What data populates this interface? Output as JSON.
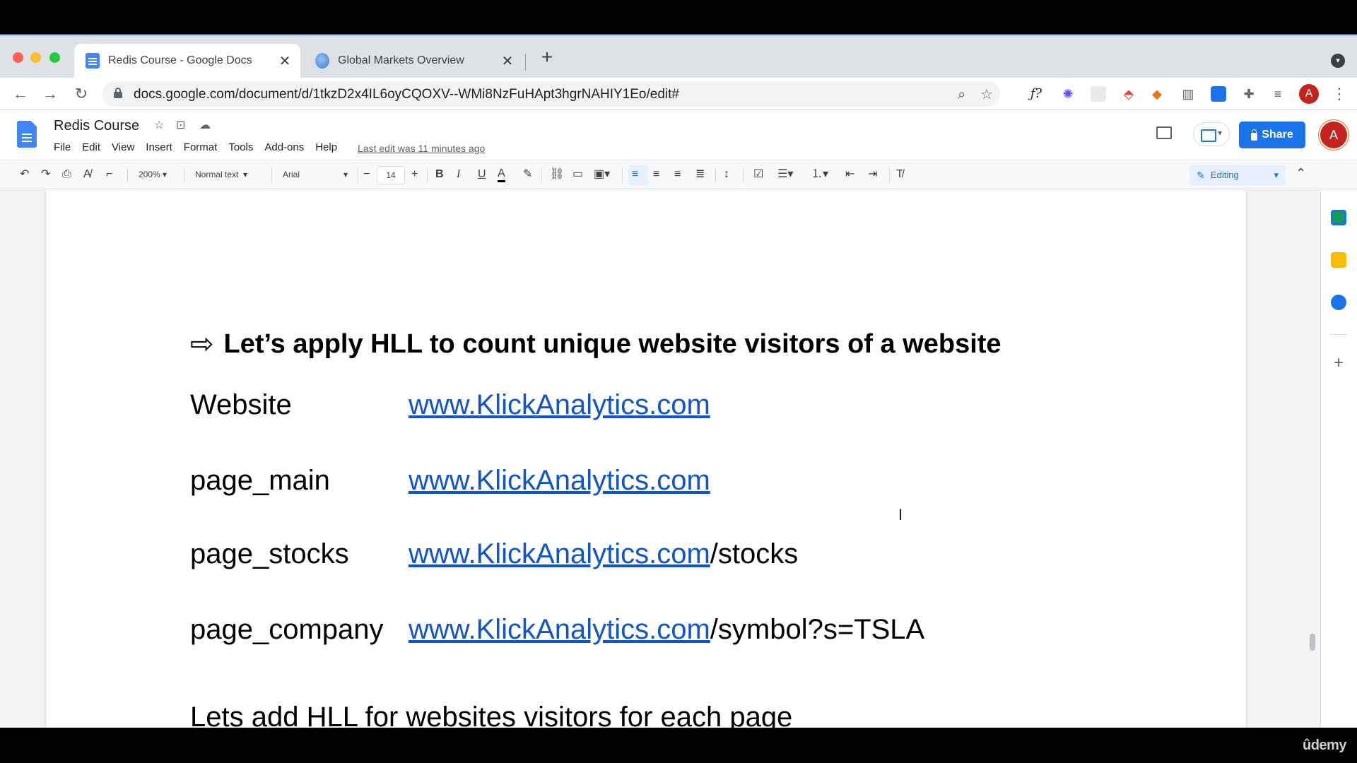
{
  "browser": {
    "tabs": [
      {
        "title": "Redis Course - Google Docs",
        "close": "✕",
        "active": true
      },
      {
        "title": "Global Markets Overview",
        "close": "✕",
        "active": false
      }
    ],
    "new_tab": "+",
    "url": "docs.google.com/document/d/1tkzD2x4IL6oyCQOXV--WMi8NzFuHApt3hgrNAHIY1Eo/edit#",
    "profile_initial": "A"
  },
  "docs": {
    "title": "Redis Course",
    "menu": [
      "File",
      "Edit",
      "View",
      "Insert",
      "Format",
      "Tools",
      "Add-ons",
      "Help"
    ],
    "last_edit": "Last edit was 11 minutes ago",
    "share_label": "Share",
    "account_initial": "A"
  },
  "toolbar": {
    "zoom": "200%",
    "style": "Normal text",
    "font": "Arial",
    "font_size": "14",
    "mode": "Editing"
  },
  "document": {
    "heading": "Let’s apply HLL to count unique website visitors of a website",
    "rows": [
      {
        "label": "Website",
        "link": "www.KlickAnalytics.com",
        "suffix": ""
      },
      {
        "label": "page_main",
        "link": "www.KlickAnalytics.com",
        "suffix": ""
      },
      {
        "label": "page_stocks",
        "link": "www.KlickAnalytics.com",
        "suffix": "/stocks"
      },
      {
        "label": "page_company",
        "link": "www.KlickAnalytics.com",
        "suffix": "/symbol?s=TSLA"
      }
    ],
    "footer_line": "Lets add HLL for websites visitors for each page"
  },
  "watermark": "ûdemy",
  "colors": {
    "link": "#1155cc",
    "share": "#1a73e8",
    "editing_bg": "#e8f0fe"
  }
}
